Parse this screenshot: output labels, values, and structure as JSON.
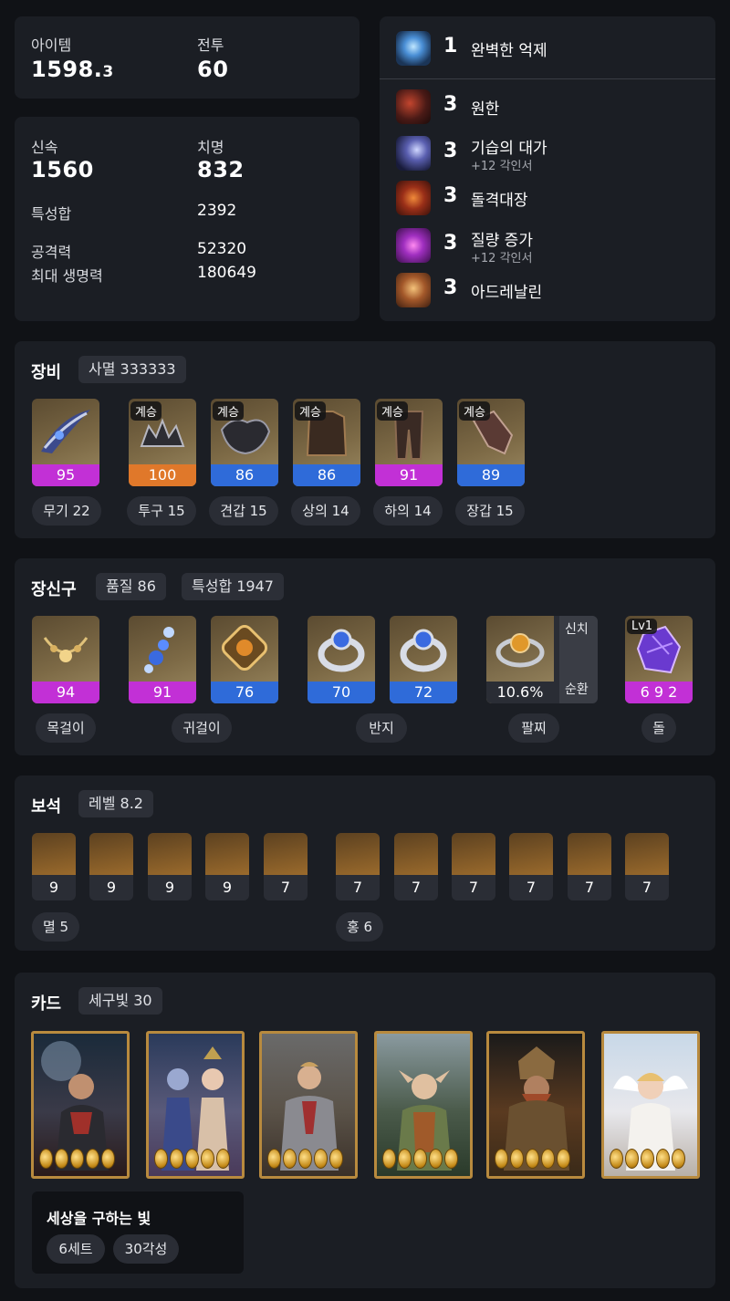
{
  "stats_basic": {
    "item_label": "아이템",
    "item_value_main": "1598.",
    "item_value_dec": "3",
    "combat_label": "전투",
    "combat_value": "60"
  },
  "stats_detail": {
    "swift_label": "신속",
    "swift_value": "1560",
    "crit_label": "치명",
    "crit_value": "832",
    "trait_label": "특성합",
    "trait_value": "2392",
    "atk_label": "공격력",
    "atk_value": "52320",
    "hp_label": "최대 생명력",
    "hp_value": "180649"
  },
  "engravings": [
    {
      "level": "1",
      "name": "완벽한 억제",
      "sub": "",
      "icon": "suppression-icon"
    },
    {
      "level": "3",
      "name": "원한",
      "sub": "",
      "icon": "grudge-icon"
    },
    {
      "level": "3",
      "name": "기습의 대가",
      "sub": "+12 각인서",
      "icon": "ambush-icon"
    },
    {
      "level": "3",
      "name": "돌격대장",
      "sub": "",
      "icon": "raid-captain-icon"
    },
    {
      "level": "3",
      "name": "질량 증가",
      "sub": "+12 각인서",
      "icon": "mass-increase-icon"
    },
    {
      "level": "3",
      "name": "아드레날린",
      "sub": "",
      "icon": "adrenaline-icon"
    }
  ],
  "equipment": {
    "title": "장비",
    "set_chip": "사멸 333333",
    "items": [
      {
        "tag": "",
        "quality": "95",
        "label": "무기 22",
        "color": "#c230d6"
      },
      {
        "tag": "계승",
        "quality": "100",
        "label": "투구 15",
        "color": "#e0782a"
      },
      {
        "tag": "계승",
        "quality": "86",
        "label": "견갑 15",
        "color": "#2f6bd9"
      },
      {
        "tag": "계승",
        "quality": "86",
        "label": "상의 14",
        "color": "#2f6bd9"
      },
      {
        "tag": "계승",
        "quality": "91",
        "label": "하의 14",
        "color": "#c230d6"
      },
      {
        "tag": "계승",
        "quality": "89",
        "label": "장갑 15",
        "color": "#2f6bd9"
      }
    ]
  },
  "accessories": {
    "title": "장신구",
    "quality_chip": "품질 86",
    "trait_chip": "특성합 1947",
    "items": [
      {
        "quality": "94",
        "color": "#c230d6"
      },
      {
        "quality": "91",
        "color": "#c230d6"
      },
      {
        "quality": "76",
        "color": "#2f6bd9"
      },
      {
        "quality": "70",
        "color": "#2f6bd9"
      },
      {
        "quality": "72",
        "color": "#2f6bd9"
      }
    ],
    "labels": {
      "necklace": "목걸이",
      "earring": "귀걸이",
      "ring": "반지",
      "bracelet": "팔찌",
      "stone": "돌"
    },
    "bracelet": {
      "value": "10.6%",
      "opt1": "신치",
      "opt2": "순환"
    },
    "stone": {
      "tag": "Lv1",
      "value": "6 9 2",
      "color": "#c230d6"
    }
  },
  "gems": {
    "title": "보석",
    "level_chip": "레벨 8.2",
    "values": [
      "9",
      "9",
      "9",
      "9",
      "7",
      "7",
      "7",
      "7",
      "7",
      "7",
      "7"
    ],
    "group1": "멸 5",
    "group2": "홍 6"
  },
  "cards": {
    "title": "카드",
    "set_chip": "세구빛 30",
    "set_name": "세상을 구하는 빛",
    "set_count": "6세트",
    "set_awaken": "30각성",
    "awakening_per_card": 5
  }
}
